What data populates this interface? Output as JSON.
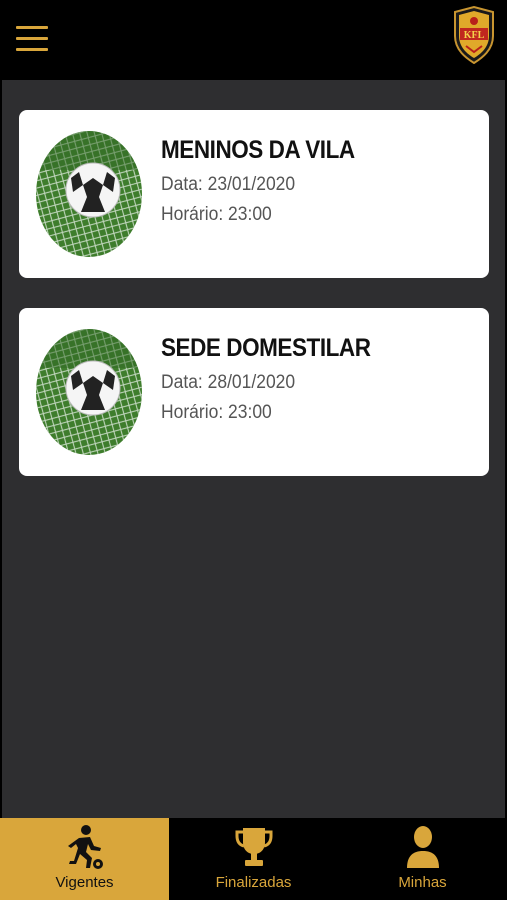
{
  "colors": {
    "accent": "#d9a63b",
    "background": "#2e2e30",
    "bar": "#000000",
    "card": "#ffffff"
  },
  "header": {
    "menu_icon": "hamburger-menu-icon",
    "logo_icon": "club-shield-logo"
  },
  "matches": [
    {
      "team": "MENINOS DA VILA",
      "date": "Data: 23/01/2020",
      "time": "Horário: 23:00",
      "image": "soccer-ball-in-net"
    },
    {
      "team": "SEDE DOMESTILAR",
      "date": "Data: 28/01/2020",
      "time": "Horário: 23:00",
      "image": "soccer-ball-in-net"
    }
  ],
  "bottom_nav": {
    "active": "Vigentes",
    "tabs": [
      {
        "label": "Vigentes",
        "icon": "soccer-player-icon"
      },
      {
        "label": "Finalizadas",
        "icon": "trophy-icon"
      },
      {
        "label": "Minhas",
        "icon": "user-icon"
      }
    ]
  }
}
